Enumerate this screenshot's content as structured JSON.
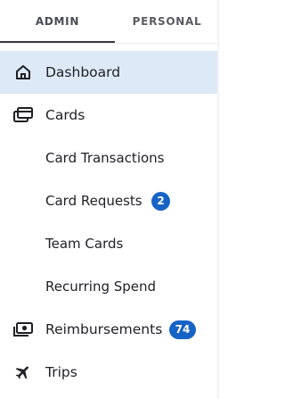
{
  "tabs": {
    "admin": "ADMIN",
    "personal": "PERSONAL",
    "active": "admin"
  },
  "nav": {
    "dashboard": {
      "label": "Dashboard",
      "icon": "home-icon"
    },
    "cards": {
      "label": "Cards",
      "icon": "cards-icon"
    },
    "card_transactions": {
      "label": "Card Transactions"
    },
    "card_requests": {
      "label": "Card Requests",
      "badge": "2"
    },
    "team_cards": {
      "label": "Team Cards"
    },
    "recurring_spend": {
      "label": "Recurring Spend"
    },
    "reimbursements": {
      "label": "Reimbursements",
      "icon": "cash-icon",
      "badge": "74"
    },
    "trips": {
      "label": "Trips",
      "icon": "airplane-icon"
    }
  },
  "colors": {
    "active_bg": "#dde9f7",
    "badge_bg": "#1763c5",
    "text": "#1f1f24"
  }
}
